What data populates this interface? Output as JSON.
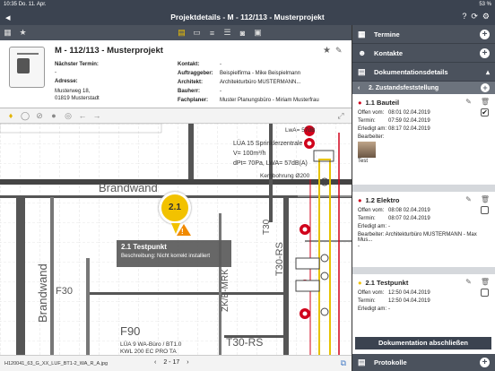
{
  "status_bar": {
    "time": "10:35",
    "date": "Do. 11. Apr.",
    "battery": "53 %"
  },
  "title_bar": {
    "title": "Projektdetails - M - 112/113 - Musterprojekt"
  },
  "project": {
    "title": "M - 112/113 - Musterprojekt",
    "next_date_label": "Nächster Termin:",
    "next_date_value": "-",
    "address_label": "Adresse:",
    "address_line1": "Musterweg 18,",
    "address_line2": "01819 Musterstadt",
    "fields": [
      {
        "label": "Kontakt:",
        "value": "-"
      },
      {
        "label": "Auftraggeber:",
        "value": "Beispielfirma - Mike Beispielmann"
      },
      {
        "label": "Architekt:",
        "value": "Architekturbüro MUSTERMANN..."
      },
      {
        "label": "Bauherr:",
        "value": "-"
      },
      {
        "label": "Fachplaner:",
        "value": "Muster Planungsbüro - Miriam Musterfrau"
      }
    ]
  },
  "plan": {
    "tooltip_title": "2.1 Testpunkt",
    "tooltip_desc": "Beschreibung: Nicht korrekt installiert",
    "marker_label": "2.1",
    "labels": {
      "brandwand": "Brandwand",
      "lwa": "LwA= 57dB",
      "sprinkler1": "LÜA 15 Sprinklerzentrale",
      "sprinkler2": "V= 100m³/h",
      "sprinkler3": "dPt= 70Pa, LWA= 57dB(A)",
      "kernbohrung": "Kernbohrung Ø200",
      "f30": "F30",
      "f90": "F90",
      "lua9a": "LÜA 9 WA-Büro / BT1.0",
      "lua9b": "KWL 200 EC PRO TA",
      "t30rs_a": "T30-RS",
      "t30rs_b": "T30-RS",
      "zke": "ZK/E-MRK",
      "t30": "T30"
    }
  },
  "bottom_bar": {
    "file": "H120041_63_G_XX_LUF_BT1-2_WA_R_A.jpg",
    "pager": "2 - 17"
  },
  "sidebar": {
    "sections": [
      "Termine",
      "Kontakte",
      "Dokumentationsdetails"
    ],
    "subheader": "2. Zustandsfeststellung",
    "entries": [
      {
        "title": "1.1 Bauteil",
        "rows": [
          {
            "k": "Offen vom:",
            "v": "08:01 02.04.2019"
          },
          {
            "k": "Termin:",
            "v": "07:59 02.04.2019"
          },
          {
            "k": "Erledigt am:",
            "v": "08:17 02.04.2019"
          }
        ],
        "bearbeiter": "Bearbeiter:",
        "caption": "Test",
        "checked": "✔"
      },
      {
        "title": "1.2 Elektro",
        "rows": [
          {
            "k": "Offen vom:",
            "v": "08:08 02.04.2019"
          },
          {
            "k": "Termin:",
            "v": "08:07 02.04.2019"
          },
          {
            "k": "Erledigt am:",
            "v": "-"
          }
        ],
        "bearbeiter": "Bearbeiter:  Architekturbüro MUSTERMANN - Max Mus...",
        "caption": "-"
      },
      {
        "title": "2.1 Testpunkt",
        "rows": [
          {
            "k": "Offen vom:",
            "v": "12:50 04.04.2019"
          },
          {
            "k": "Termin:",
            "v": "12:50 04.04.2019"
          },
          {
            "k": "Erledigt am:",
            "v": "-"
          }
        ]
      }
    ],
    "button": "Dokumentation abschließen",
    "protokolle": "Protokolle"
  },
  "colors": {
    "header": "#3b4350",
    "toolbar": "#4b525d",
    "accent": "#f2c200",
    "red": "#d0021b"
  }
}
